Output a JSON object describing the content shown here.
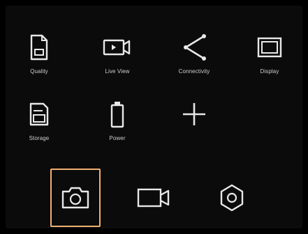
{
  "settings_menu": {
    "items": [
      {
        "label": "Quality",
        "icon": "document-icon"
      },
      {
        "label": "Live View",
        "icon": "live-view-icon"
      },
      {
        "label": "Connectivity",
        "icon": "share-icon"
      },
      {
        "label": "Display",
        "icon": "display-icon"
      },
      {
        "label": "Storage",
        "icon": "storage-icon"
      },
      {
        "label": "Power",
        "icon": "battery-icon"
      },
      {
        "label": "",
        "icon": "add-icon"
      }
    ]
  },
  "bottom_tabs": [
    {
      "icon": "camera-icon",
      "active": true
    },
    {
      "icon": "video-camera-icon",
      "active": false
    },
    {
      "icon": "settings-gear-icon",
      "active": false
    }
  ],
  "colors": {
    "background": "#000000",
    "icon": "#e8e8e8",
    "accent": "#f2b073"
  }
}
